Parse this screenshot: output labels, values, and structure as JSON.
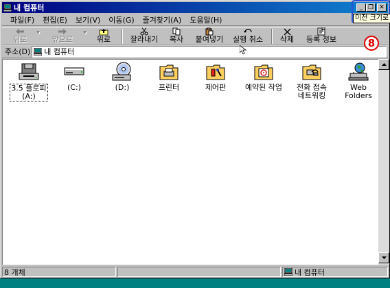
{
  "window": {
    "title": "내 컴퓨터"
  },
  "title_buttons": {
    "minimize": "_",
    "restore": "❐",
    "close": "✕"
  },
  "tooltip": "이전 크기로",
  "badge": "8",
  "menu": [
    {
      "label": "파일(F)"
    },
    {
      "label": "편집(E)"
    },
    {
      "label": "보기(V)"
    },
    {
      "label": "이동(G)"
    },
    {
      "label": "즐겨찾기(A)"
    },
    {
      "label": "도움말(H)"
    }
  ],
  "toolbar": {
    "back": "뒤로",
    "forward": "앞으로",
    "up": "위로",
    "cut": "잘라내기",
    "copy": "복사",
    "paste": "붙여넣기",
    "undo": "실행 취소",
    "delete": "삭제",
    "properties": "등록 정보"
  },
  "address": {
    "label": "주소(D)",
    "value": "내 컴퓨터"
  },
  "items": [
    {
      "line1": "3.5 플로피",
      "line2": "(A:)",
      "icon": "floppy-drive-icon"
    },
    {
      "line1": "(C:)",
      "line2": "",
      "icon": "hard-drive-icon"
    },
    {
      "line1": "(D:)",
      "line2": "",
      "icon": "cd-drive-icon"
    },
    {
      "line1": "프린터",
      "line2": "",
      "icon": "printers-folder-icon"
    },
    {
      "line1": "제어판",
      "line2": "",
      "icon": "control-panel-icon"
    },
    {
      "line1": "예약된 작업",
      "line2": "",
      "icon": "scheduled-tasks-icon"
    },
    {
      "line1": "전화 접속",
      "line2": "네트워킹",
      "icon": "dialup-networking-icon"
    },
    {
      "line1": "Web Folders",
      "line2": "",
      "icon": "web-folders-icon"
    }
  ],
  "status": {
    "count": "8 개체",
    "location": "내 컴퓨터"
  },
  "colors": {
    "titlebar_start": "#000080",
    "titlebar_end": "#1084d0",
    "desktop": "#008080",
    "badge": "#e00000",
    "highlight": "#2a52d8"
  }
}
